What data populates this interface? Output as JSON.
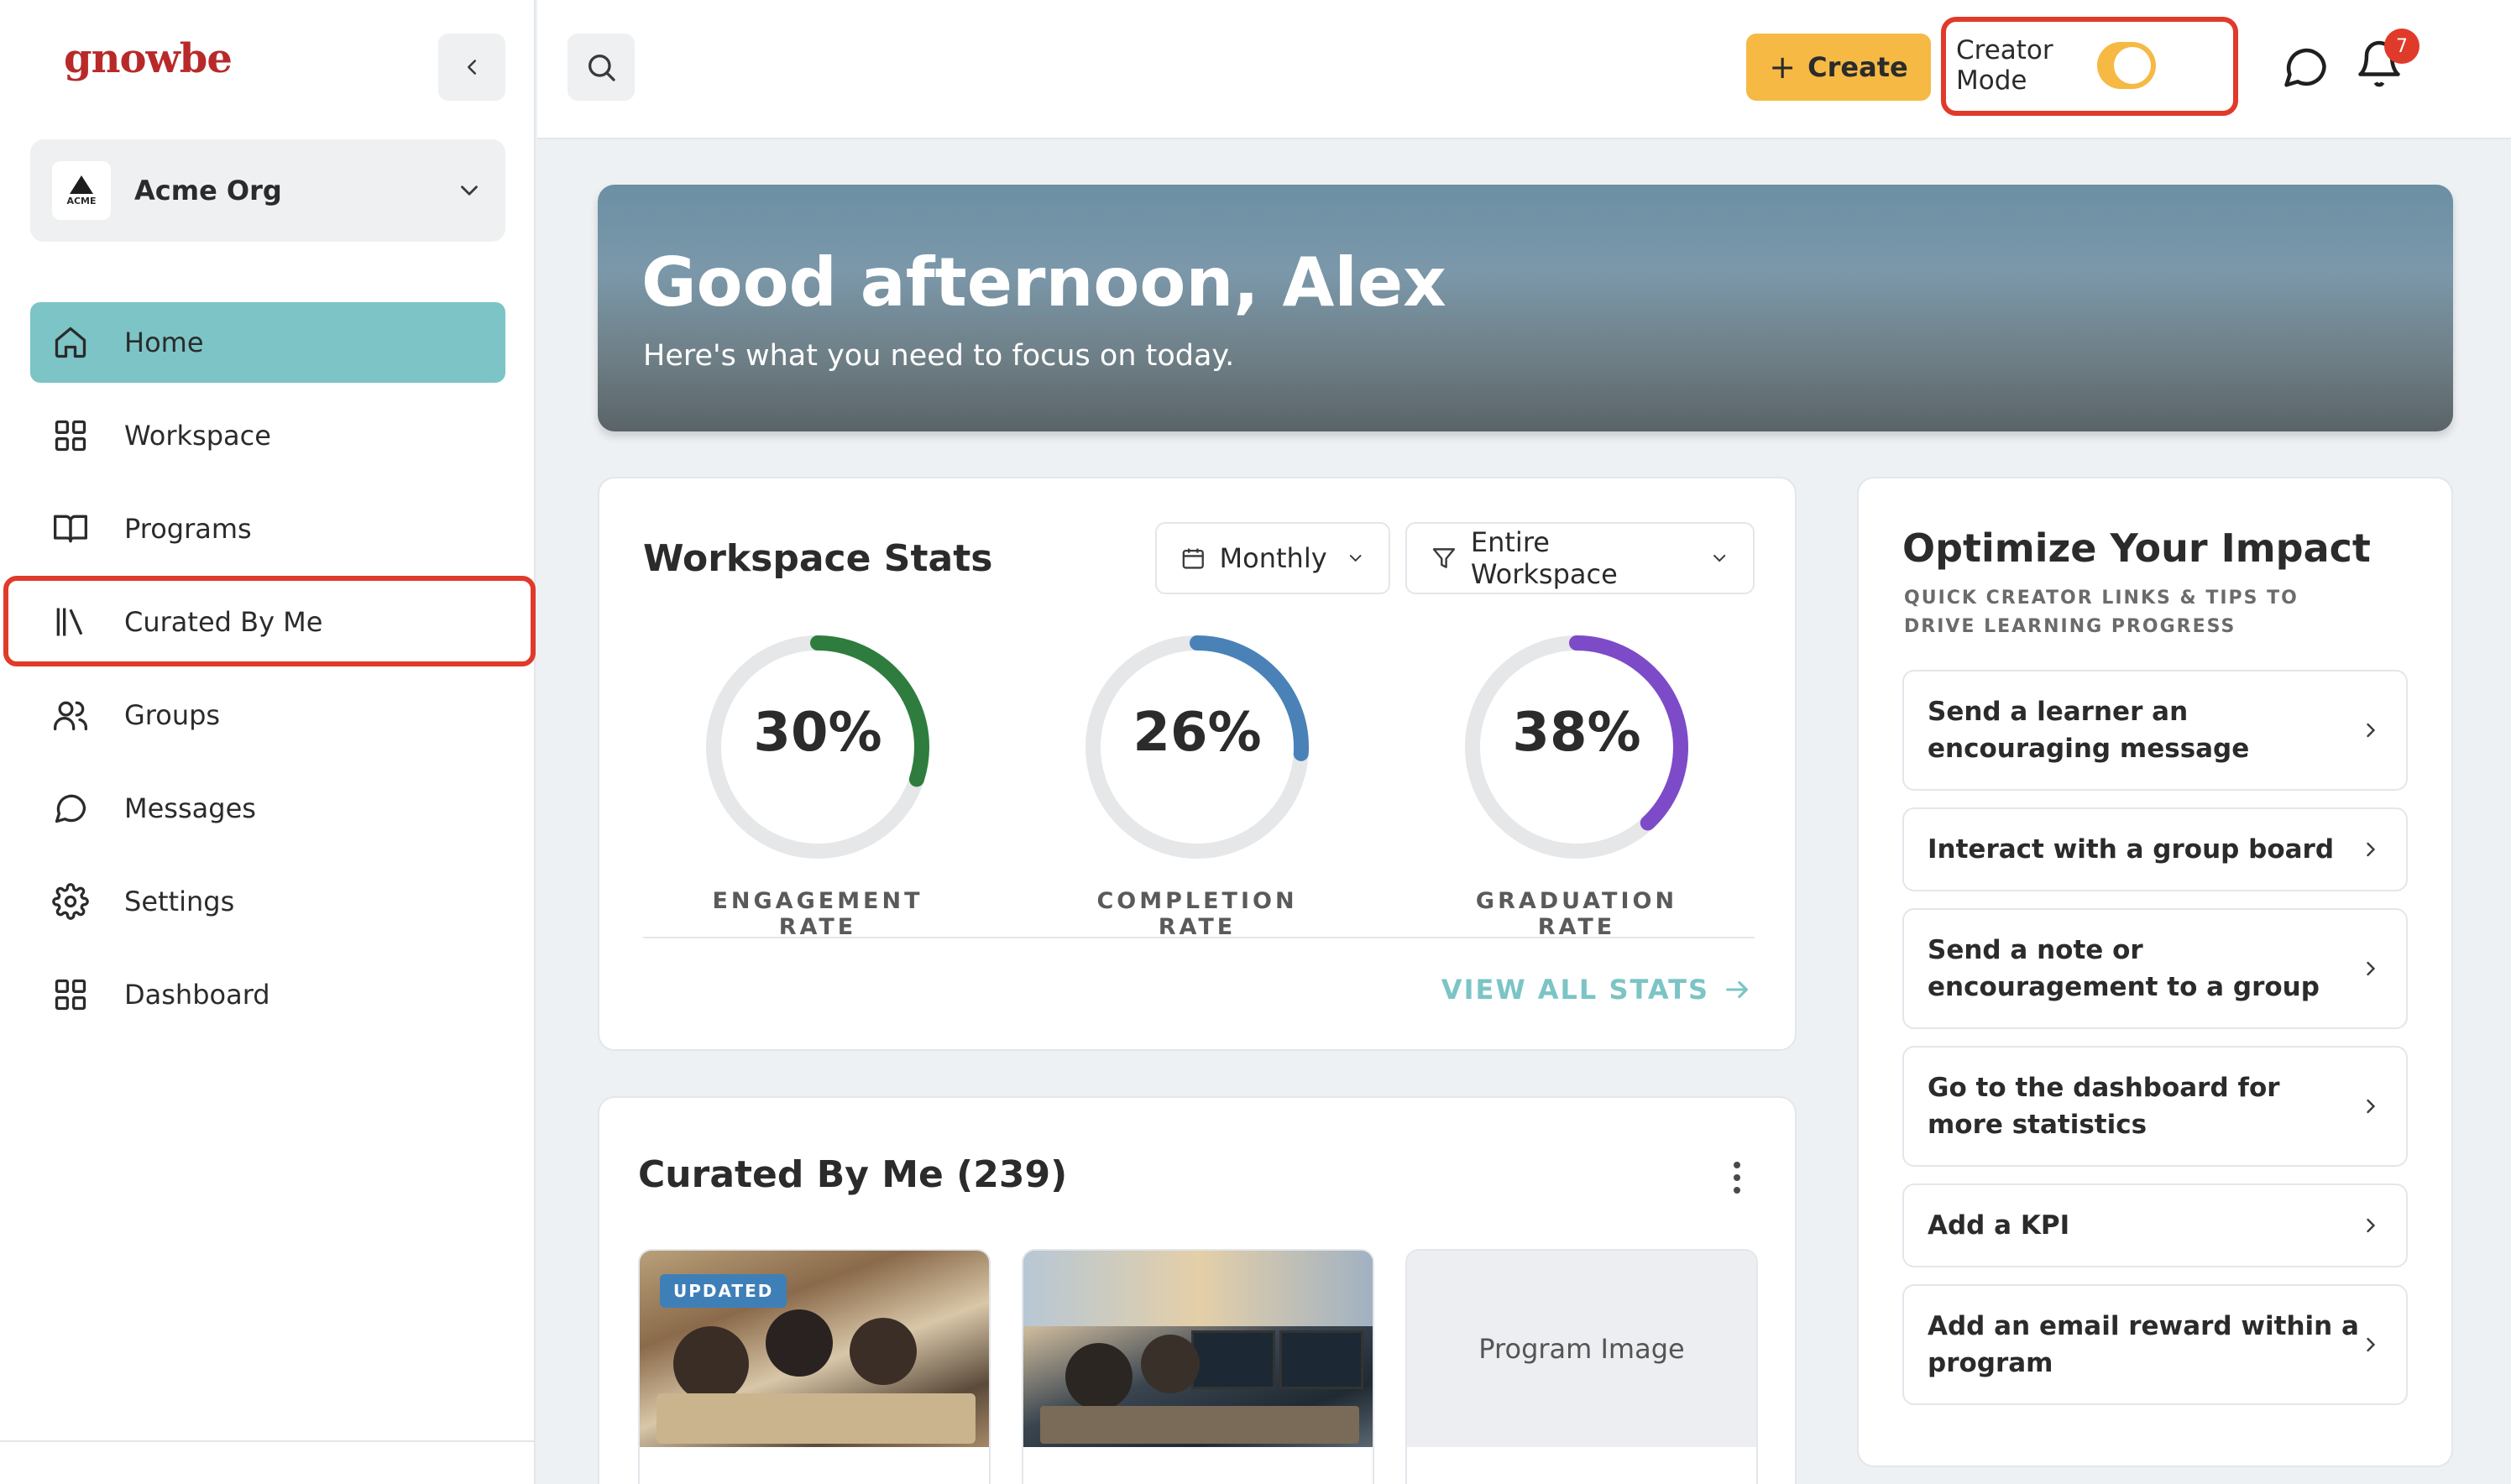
{
  "sidebar": {
    "logo": "gnowbe",
    "org": {
      "name": "Acme Org",
      "logo_text": "ACME"
    },
    "items": [
      {
        "label": "Home",
        "icon": "home-icon",
        "active": true
      },
      {
        "label": "Workspace",
        "icon": "grid-icon"
      },
      {
        "label": "Programs",
        "icon": "book-icon"
      },
      {
        "label": "Curated By Me",
        "icon": "library-icon"
      },
      {
        "label": "Groups",
        "icon": "users-icon"
      },
      {
        "label": "Messages",
        "icon": "chat-icon"
      },
      {
        "label": "Settings",
        "icon": "gear-icon"
      },
      {
        "label": "Dashboard",
        "icon": "grid-icon"
      }
    ]
  },
  "topbar": {
    "create_label": "Create",
    "creator_mode_label": "Creator Mode",
    "creator_mode_on": true,
    "notification_count": "7"
  },
  "hero": {
    "title": "Good afternoon, Alex",
    "subtitle": "Here's what you need to focus on today."
  },
  "stats": {
    "title": "Workspace Stats",
    "period": "Monthly",
    "scope": "Entire Workspace",
    "gauges": [
      {
        "value": "30%",
        "fraction": 0.3,
        "label": "ENGAGEMENT RATE",
        "color": "#2e7d3e"
      },
      {
        "value": "26%",
        "fraction": 0.26,
        "label": "COMPLETION RATE",
        "color": "#4a82b8"
      },
      {
        "value": "38%",
        "fraction": 0.38,
        "label": "GRADUATION RATE",
        "color": "#7d4bc8"
      }
    ],
    "view_all": "VIEW ALL STATS"
  },
  "curated": {
    "title": "Curated By Me (239)",
    "cards": [
      {
        "tag": "UPDATED"
      },
      {
        "tag": ""
      },
      {
        "placeholder": "Program Image"
      }
    ]
  },
  "impact": {
    "title": "Optimize Your Impact",
    "subtitle": "QUICK CREATOR LINKS & TIPS TO DRIVE LEARNING PROGRESS",
    "items": [
      "Send a learner an encouraging message",
      "Interact with a group board",
      "Send a note or encouragement to a group",
      "Go to the dashboard for more statistics",
      "Add a KPI",
      "Add an email reward within a program"
    ]
  },
  "colors": {
    "accent_teal": "#7cc4c6",
    "create_yellow": "#f5b944",
    "highlight_red": "#e03a2a",
    "logo_red": "#b82a2a"
  }
}
